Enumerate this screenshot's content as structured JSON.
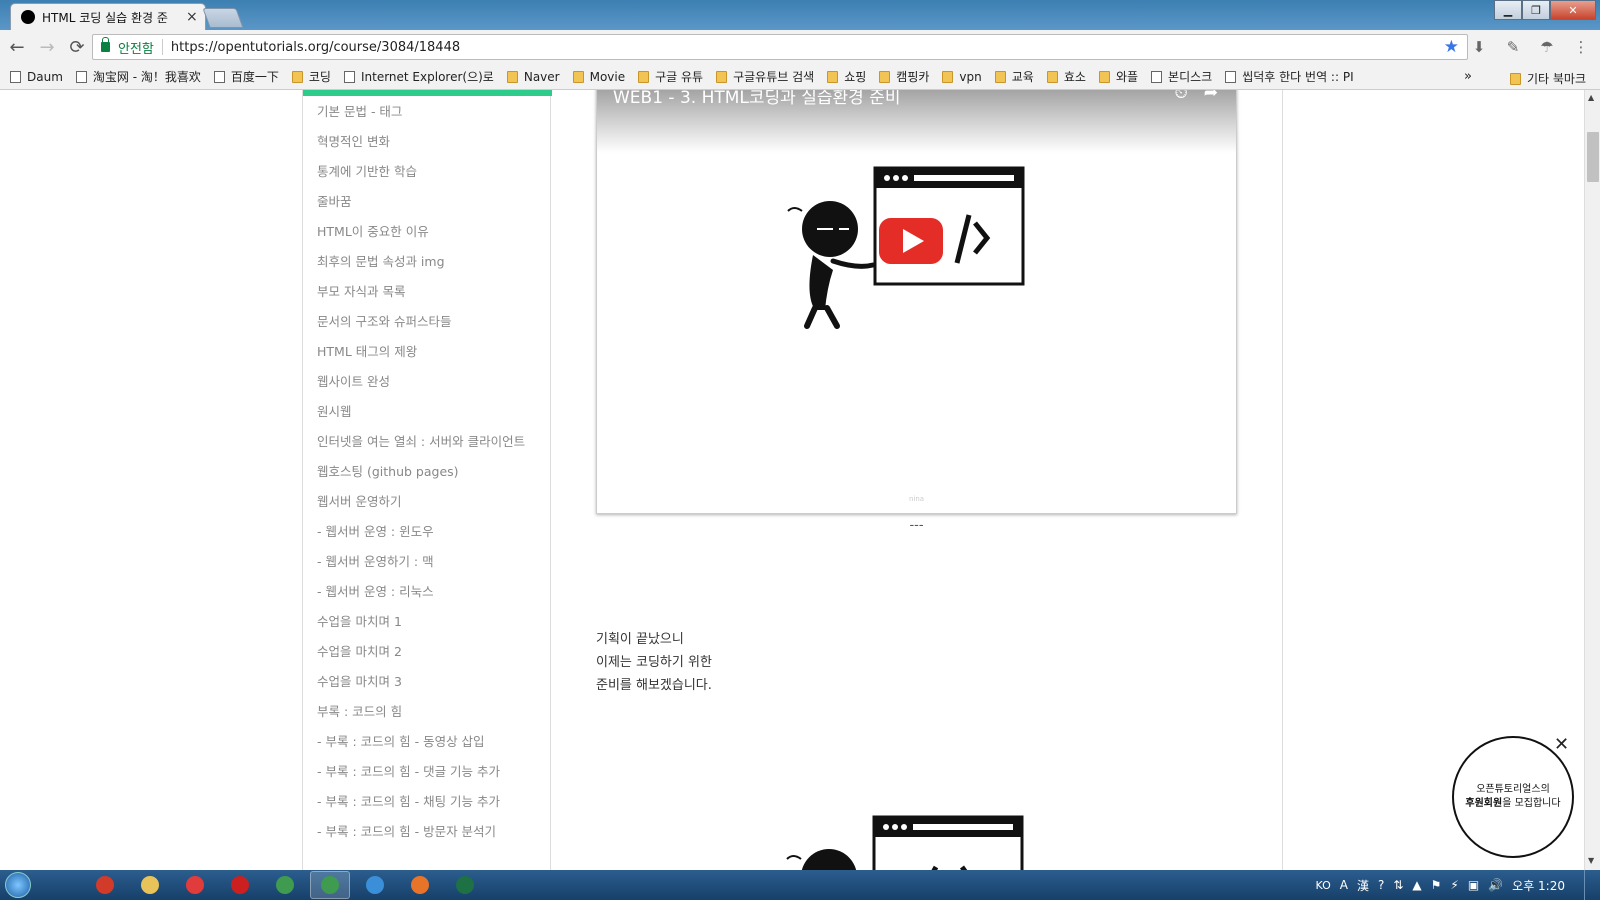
{
  "browser": {
    "tab_title": "HTML 코딩 실습 환경 준",
    "window_buttons": {
      "minimize": "▁",
      "maximize": "❐",
      "close": "✕"
    },
    "nav": {
      "back": "←",
      "forward": "→",
      "reload": "⟳"
    },
    "secure_label": "안전함",
    "url": "https://opentutorials.org/course/3084/18448",
    "star": "★",
    "extensions": [
      "download-icon",
      "leaf-icon",
      "umbrella-icon",
      "menu-icon"
    ],
    "extension_glyphs": [
      "⬇",
      "✎",
      "☂",
      "⋮"
    ]
  },
  "bookmarks": {
    "items": [
      {
        "label": "Daum",
        "type": "page"
      },
      {
        "label": "淘宝网 - 淘！我喜欢",
        "type": "page"
      },
      {
        "label": "百度一下",
        "type": "page"
      },
      {
        "label": "코딩",
        "type": "folder"
      },
      {
        "label": "Internet Explorer(으)로",
        "type": "page"
      },
      {
        "label": "Naver",
        "type": "folder"
      },
      {
        "label": "Movie",
        "type": "folder"
      },
      {
        "label": "구글 유튜",
        "type": "folder"
      },
      {
        "label": "구글유튜브 검색",
        "type": "folder"
      },
      {
        "label": "쇼핑",
        "type": "folder"
      },
      {
        "label": "캠핑카",
        "type": "folder"
      },
      {
        "label": "vpn",
        "type": "folder"
      },
      {
        "label": "교육",
        "type": "folder"
      },
      {
        "label": "효소",
        "type": "folder"
      },
      {
        "label": "와플",
        "type": "folder"
      },
      {
        "label": "본디스크",
        "type": "page"
      },
      {
        "label": "씹덕후 한다 번역 :: PI",
        "type": "page"
      }
    ],
    "more": "»",
    "other": "기타 북마크"
  },
  "sidebar": {
    "items": [
      "기본 문법 - 태그",
      "혁명적인 변화",
      "통계에 기반한 학습",
      "줄바꿈",
      "HTML이 중요한 이유",
      "최후의 문법 속성과 img",
      "부모 자식과 목록",
      "문서의 구조와 슈퍼스타들",
      "HTML 태그의 제왕",
      "웹사이트 완성",
      "원시웹",
      "인터넷을 여는 열쇠 : 서버와 클라이언트",
      "웹호스팅 (github pages)",
      "웹서버 운영하기",
      "- 웹서버 운영 : 윈도우",
      "- 웹서버 운영하기 : 맥",
      "- 웹서버 운영 : 리눅스",
      "수업을 마치며 1",
      "수업을 마치며 2",
      "수업을 마치며 3",
      "부록 : 코드의 힘",
      "- 부록 : 코드의 힘 - 동영상 삽입",
      "- 부록 : 코드의 힘 - 댓글 기능 추가",
      "- 부록 : 코드의 힘 - 채팅 기능 추가",
      "- 부록 : 코드의 힘 - 방문자 분석기"
    ]
  },
  "main": {
    "video_title": "WEB1 - 3. HTML코딩과 실습환경 준비",
    "video_glyphs": {
      "clock": "⏲",
      "share": "➦"
    },
    "video_watermark": "nina",
    "divider": "---",
    "paragraph": [
      "기획이 끝났으니",
      "이제는 코딩하기 위한",
      "준비를 해보겠습니다."
    ]
  },
  "scrollbar_glyphs": {
    "up": "▲",
    "down": "▼"
  },
  "sponsor": {
    "line1": "오픈튜토리얼스의",
    "line2_bold": "후원회원",
    "line2_rest": "을 모집합니다",
    "close": "✕"
  },
  "taskbar": {
    "apps": [
      {
        "name": "app-red-swirl",
        "color": "#d23a2a"
      },
      {
        "name": "file-explorer",
        "color": "#e8c35a"
      },
      {
        "name": "app-red-square",
        "color": "#e23b3b"
      },
      {
        "name": "opera",
        "color": "#cc1f1f"
      },
      {
        "name": "chrome",
        "color": "#3e9b4f"
      },
      {
        "name": "chrome-active",
        "color": "#3e9b4f"
      },
      {
        "name": "internet-explorer",
        "color": "#3a8fd8"
      },
      {
        "name": "firefox",
        "color": "#e8742a"
      },
      {
        "name": "excel",
        "color": "#1e7145"
      }
    ],
    "tray": {
      "lang": "KO",
      "ime_a": "A",
      "ime_han": "漢",
      "help": "?",
      "up": "▲",
      "flag": "⚑",
      "power": "⚡",
      "network": "▣",
      "volume": "🔊",
      "arrow": "⇅"
    },
    "clock": "오후 1:20"
  },
  "colors": {
    "accent_green": "#2ecc8a",
    "secure_green": "#0b8043",
    "youtube_red": "#e52d27"
  }
}
